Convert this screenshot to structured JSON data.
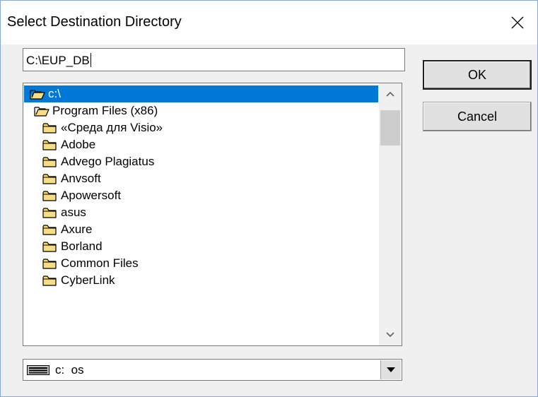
{
  "dialog": {
    "title": "Select Destination Directory",
    "close_icon": "close-icon"
  },
  "path_input": {
    "value": "C:\\EUP_DB"
  },
  "buttons": {
    "ok_label": "OK",
    "cancel_label": "Cancel"
  },
  "folder_list": {
    "items": [
      {
        "label": "c:\\",
        "icon": "open-folder-icon",
        "selected": true
      },
      {
        "label": "Program Files (x86)",
        "icon": "open-folder-icon",
        "selected": false
      },
      {
        "label": "«Среда для Visio»",
        "icon": "folder-icon",
        "selected": false
      },
      {
        "label": "Adobe",
        "icon": "folder-icon",
        "selected": false
      },
      {
        "label": "Advego Plagiatus",
        "icon": "folder-icon",
        "selected": false
      },
      {
        "label": "Anvsoft",
        "icon": "folder-icon",
        "selected": false
      },
      {
        "label": "Apowersoft",
        "icon": "folder-icon",
        "selected": false
      },
      {
        "label": "asus",
        "icon": "folder-icon",
        "selected": false
      },
      {
        "label": "Axure",
        "icon": "folder-icon",
        "selected": false
      },
      {
        "label": "Borland",
        "icon": "folder-icon",
        "selected": false
      },
      {
        "label": "Common Files",
        "icon": "folder-icon",
        "selected": false
      },
      {
        "label": "CyberLink",
        "icon": "folder-icon",
        "selected": false
      }
    ]
  },
  "drive_select": {
    "value": "c:  os",
    "icon": "drive-icon"
  },
  "colors": {
    "selection": "#0078d7",
    "folder_fill": "#f9dd82",
    "folder_stroke": "#000000"
  }
}
